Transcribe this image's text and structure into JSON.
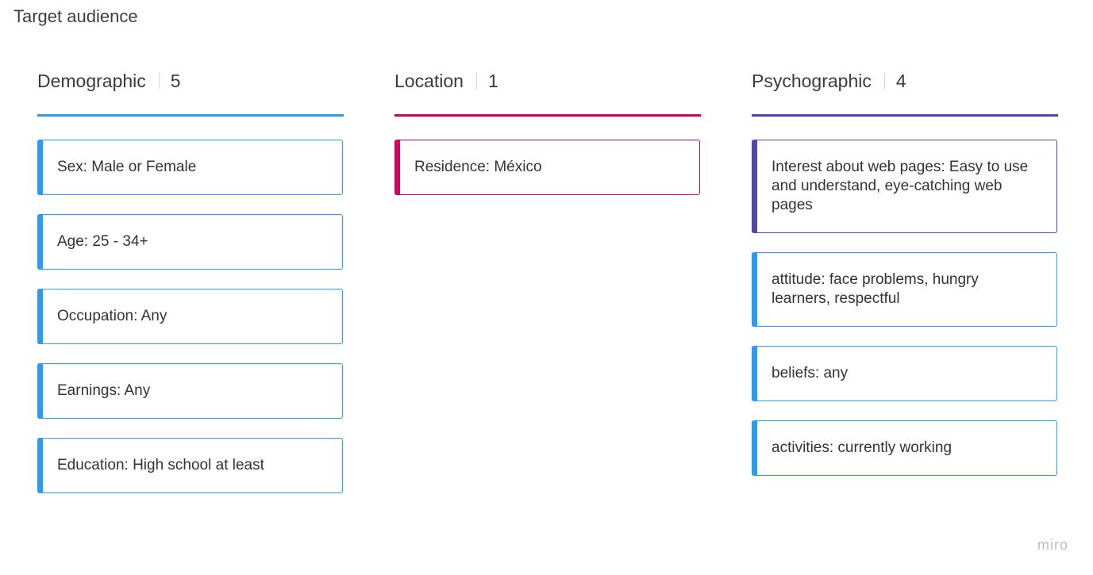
{
  "frame": {
    "title": "Target audience"
  },
  "columns": [
    {
      "name": "Demographic",
      "count": "5",
      "accent": "#2d9bf0",
      "cards": [
        {
          "text": "Sex: Male or Female"
        },
        {
          "text": "Age: 25 - 34+"
        },
        {
          "text": "Occupation: Any"
        },
        {
          "text": "Earnings: Any"
        },
        {
          "text": "Education:  High school at least"
        }
      ]
    },
    {
      "name": "Location",
      "count": "1",
      "accent": "#da0063",
      "cards": [
        {
          "text": "Residence: México"
        }
      ]
    },
    {
      "name": "Psychographic",
      "count": "4",
      "accent": "#4f46b0",
      "cards": [
        {
          "text": "Interest about web pages: Easy to use and understand, eye-catching web pages",
          "accent": "#4f46b0"
        },
        {
          "text": "attitude: face problems, hungry learners, respectful",
          "accent": "#2d9bf0"
        },
        {
          "text": "beliefs: any",
          "accent": "#2d9bf0"
        },
        {
          "text": "activities: currently working",
          "accent": "#2d9bf0"
        }
      ]
    }
  ],
  "watermark": {
    "logo": "miro"
  }
}
